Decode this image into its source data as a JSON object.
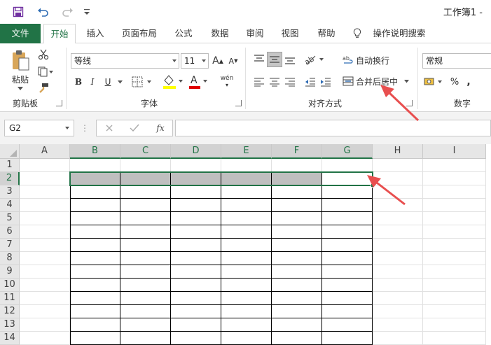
{
  "window": {
    "title": "工作簿1 -"
  },
  "quick_access": {
    "icons": [
      "save-icon",
      "undo-icon",
      "redo-icon",
      "customize-icon"
    ]
  },
  "tabs": [
    {
      "label": "文件"
    },
    {
      "label": "开始"
    },
    {
      "label": "插入"
    },
    {
      "label": "页面布局"
    },
    {
      "label": "公式"
    },
    {
      "label": "数据"
    },
    {
      "label": "审阅"
    },
    {
      "label": "视图"
    },
    {
      "label": "帮助"
    },
    {
      "label": "操作说明搜索"
    }
  ],
  "active_tab": "开始",
  "ribbon": {
    "clipboard": {
      "paste_label": "粘贴",
      "group_label": "剪贴板"
    },
    "font": {
      "font_name": "等线",
      "font_size": "11",
      "group_label": "字体",
      "bold": "B",
      "italic": "I",
      "underline": "U",
      "phonetic": "wén"
    },
    "alignment": {
      "wrap_text": "自动换行",
      "merge_center": "合并后居中",
      "group_label": "对齐方式"
    },
    "number": {
      "format": "常规",
      "percent": "%",
      "comma": ",",
      "group_label": "数字"
    }
  },
  "formula_bar": {
    "name_box": "G2",
    "formula": ""
  },
  "grid": {
    "columns": [
      "A",
      "B",
      "C",
      "D",
      "E",
      "F",
      "G",
      "H",
      "I"
    ],
    "rows": [
      "1",
      "2",
      "3",
      "4",
      "5",
      "6",
      "7",
      "8",
      "9",
      "10",
      "11",
      "12",
      "13",
      "14"
    ],
    "selected_range": "B2:G2",
    "bordered_range": "B2:G14",
    "shaded_range": "B2:F2",
    "shade_color": "#bfbfbf",
    "accent_color": "#217346"
  },
  "annotations": {
    "arrow_color": "#e84f4f",
    "arrows": [
      "arrow-to-merge-center",
      "arrow-to-selection"
    ]
  }
}
